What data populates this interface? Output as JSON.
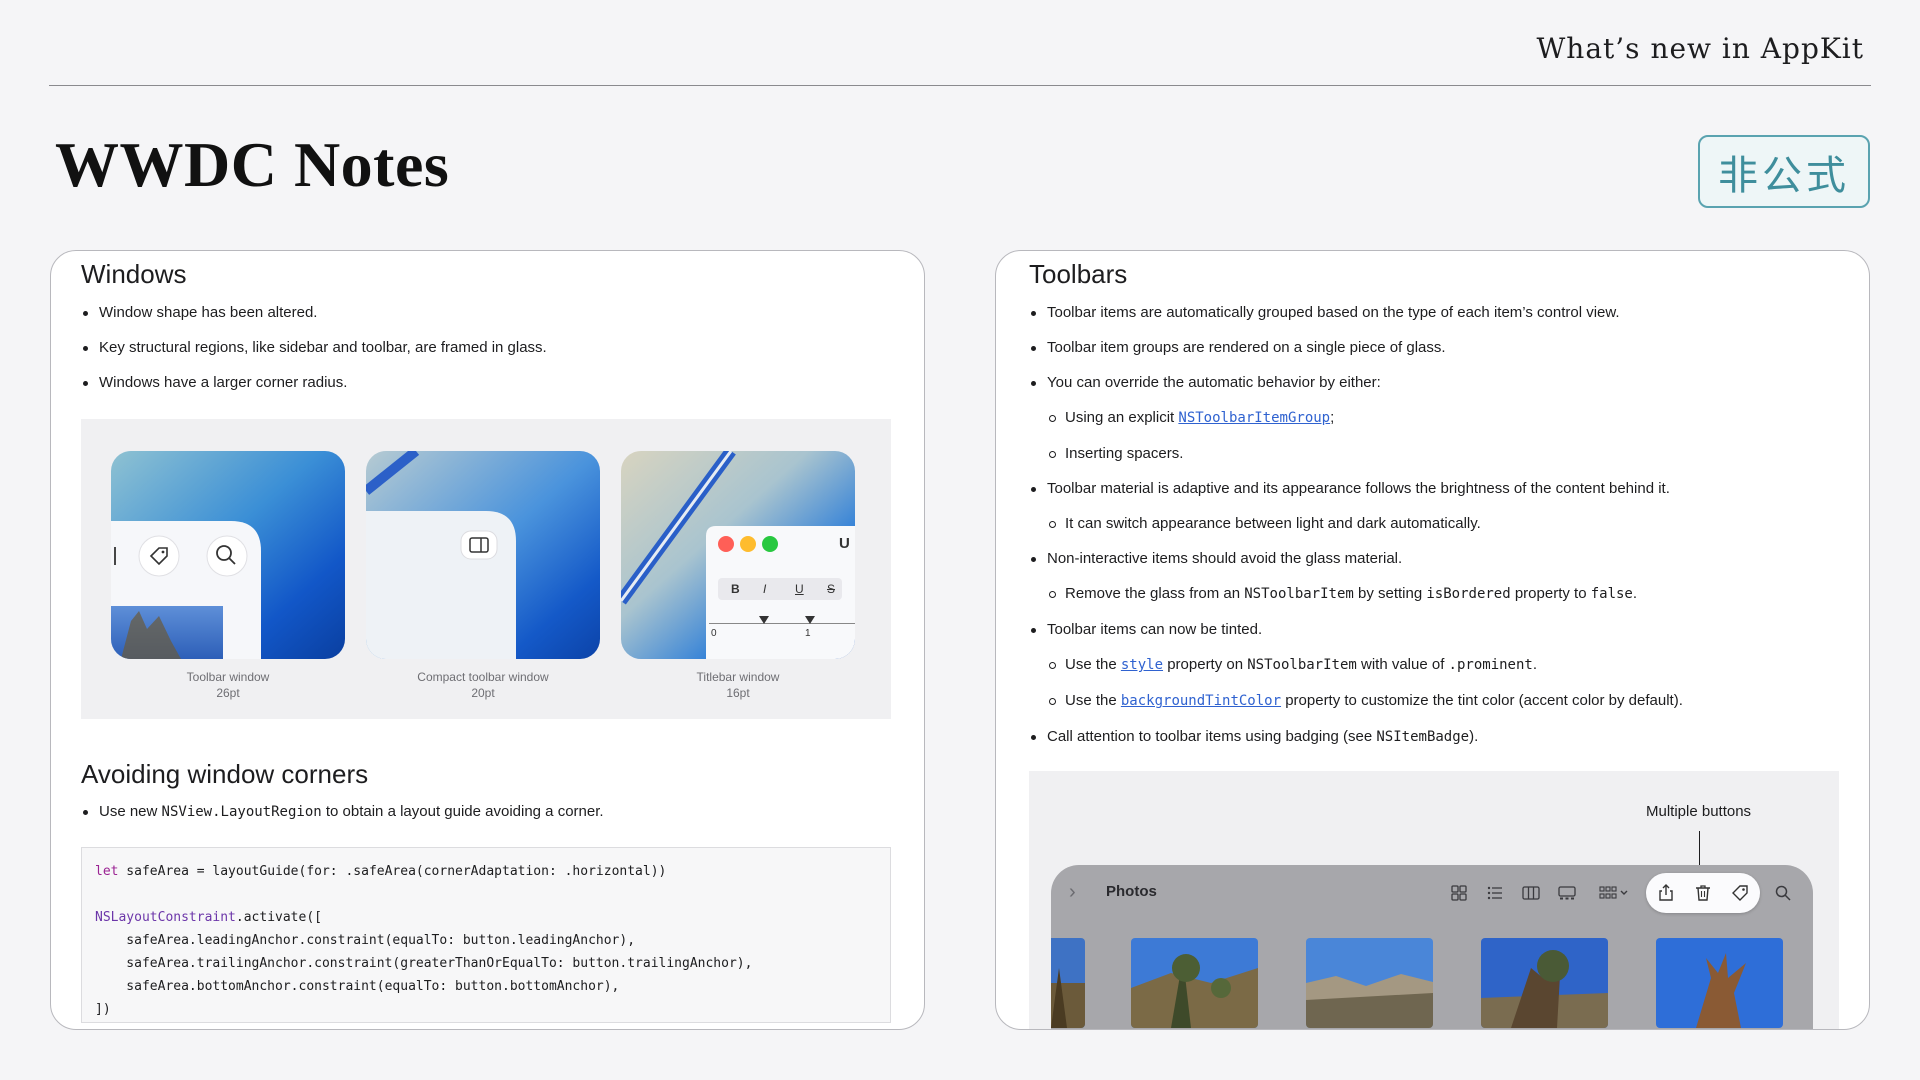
{
  "header": {
    "title": "What’s new in AppKit"
  },
  "page_title": "WWDC Notes",
  "badge": "非公式",
  "windows": {
    "title": "Windows",
    "bullets": [
      "Window shape has been altered.",
      "Key structural regions, like sidebar and toolbar, are framed in glass.",
      "Windows have a larger corner radius."
    ],
    "thumbs": [
      {
        "name": "Toolbar window",
        "size": "26pt"
      },
      {
        "name": "Compact toolbar window",
        "size": "20pt"
      },
      {
        "name": "Titlebar window",
        "size": "16pt"
      }
    ],
    "titlebar_demo": {
      "bold": "B",
      "italic": "I",
      "underline": "U",
      "strike": "S",
      "ruler_0": "0",
      "ruler_1": "1",
      "cut_text": "U"
    }
  },
  "avoid": {
    "title": "Avoiding window corners",
    "bullet_pre": "Use new ",
    "bullet_code": "NSView.LayoutRegion",
    "bullet_post": " to obtain a layout guide avoiding a corner.",
    "code": {
      "l1_kw": "let",
      "l1_rest": " safeArea = layoutGuide(for: .safeArea(cornerAdaptation: .horizontal))",
      "l2_ty": "NSLayoutConstraint",
      "l2_rest": ".activate([",
      "l3": "    safeArea.leadingAnchor.constraint(equalTo: button.leadingAnchor),",
      "l4": "    safeArea.trailingAnchor.constraint(greaterThanOrEqualTo: button.trailingAnchor),",
      "l5": "    safeArea.bottomAnchor.constraint(equalTo: button.bottomAnchor),",
      "l6": "])"
    }
  },
  "toolbars": {
    "title": "Toolbars",
    "b1": "Toolbar items are automatically grouped based on the type of each item’s control view.",
    "b2": "Toolbar item groups are rendered on a single piece of glass.",
    "b3": "You can override the automatic behavior by either:",
    "b3a_pre": "Using an explicit ",
    "b3a_link": "NSToolbarItemGroup",
    "b3a_post": ";",
    "b3b": "Inserting spacers.",
    "b4": "Toolbar material is adaptive and its appearance follows the brightness of the content behind it.",
    "b4a": "It can switch appearance between light and dark automatically.",
    "b5": "Non-interactive items should avoid the glass material.",
    "b5a_pre": "Remove the glass from an ",
    "b5a_code1": "NSToolbarItem",
    "b5a_mid": " by setting ",
    "b5a_code2": "isBordered",
    "b5a_mid2": " property to ",
    "b5a_code3": "false",
    "b5a_post": ".",
    "b6": "Toolbar items can now be tinted.",
    "b6a_pre": "Use the ",
    "b6a_link": "style",
    "b6a_mid": " property on ",
    "b6a_code1": "NSToolbarItem",
    "b6a_mid2": " with value of ",
    "b6a_code2": ".prominent",
    "b6a_post": ".",
    "b6b_pre": "Use the ",
    "b6b_link": "backgroundTintColor",
    "b6b_post": " property to customize the tint color (accent color by default).",
    "b7_pre": "Call attention to toolbar items using badging (see ",
    "b7_code": "NSItemBadge",
    "b7_post": ").",
    "callout": "Multiple buttons",
    "app_name": "Photos"
  },
  "colors": {
    "accent_link": "#2f62d0",
    "badge_border": "#5aa3b0",
    "badge_text": "#3f8e9c",
    "traffic_red": "#ff5f57",
    "traffic_yellow": "#febc2e",
    "traffic_green": "#28c840"
  },
  "icons": [
    "tag-icon",
    "search-icon",
    "sidebar-icon",
    "grid-icon",
    "list-icon",
    "columns-icon",
    "gallery-icon",
    "group-icon",
    "share-icon",
    "trash-icon",
    "chevron-right-icon"
  ]
}
